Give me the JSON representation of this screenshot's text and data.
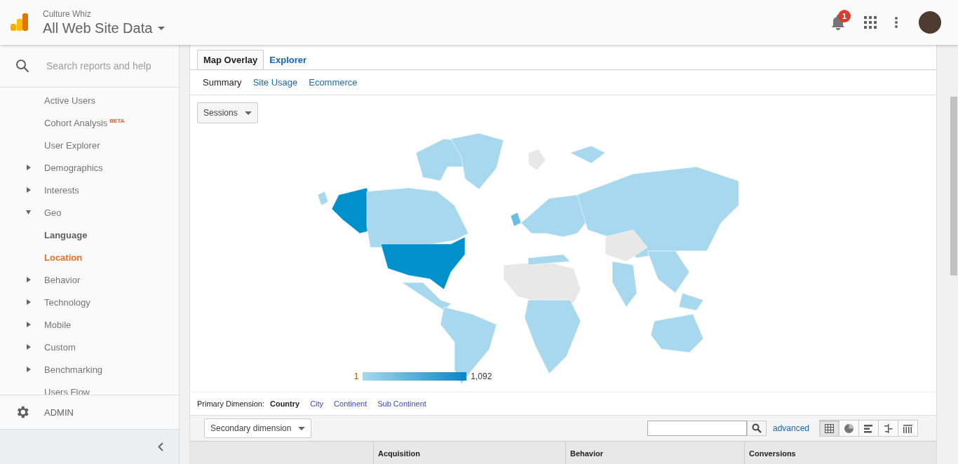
{
  "header": {
    "account": "Culture Whiz",
    "property": "All Web Site Data",
    "notifications": "1"
  },
  "sidebar": {
    "search": {
      "placeholder": "Search reports and help"
    },
    "items": [
      {
        "label": "Active Users",
        "kind": "leaf",
        "selected": false
      },
      {
        "label": "Cohort Analysis",
        "badge": "BETA",
        "kind": "leaf",
        "selected": false
      },
      {
        "label": "User Explorer",
        "kind": "leaf",
        "selected": false
      },
      {
        "label": "Demographics",
        "kind": "group",
        "expanded": false
      },
      {
        "label": "Interests",
        "kind": "group",
        "expanded": false
      },
      {
        "label": "Geo",
        "kind": "group",
        "expanded": true,
        "children": [
          {
            "label": "Language",
            "kind": "leaf",
            "selected": false
          },
          {
            "label": "Location",
            "kind": "leaf",
            "selected": true
          }
        ]
      },
      {
        "label": "Behavior",
        "kind": "group",
        "expanded": false
      },
      {
        "label": "Technology",
        "kind": "group",
        "expanded": false
      },
      {
        "label": "Mobile",
        "kind": "group",
        "expanded": false
      },
      {
        "label": "Custom",
        "kind": "group",
        "expanded": false
      },
      {
        "label": "Benchmarking",
        "kind": "group",
        "expanded": false
      },
      {
        "label": "Users Flow",
        "kind": "leaf",
        "selected": false
      }
    ],
    "admin": "ADMIN"
  },
  "tabs": [
    {
      "label": "Map Overlay",
      "selected": true
    },
    {
      "label": "Explorer",
      "selected": false
    }
  ],
  "subtabs": [
    {
      "label": "Summary",
      "selected": true
    },
    {
      "label": "Site Usage",
      "selected": false
    },
    {
      "label": "Ecommerce",
      "selected": false
    }
  ],
  "metric_dropdown": "Sessions",
  "legend": {
    "min": "1",
    "max": "1,092"
  },
  "primary_dimension": {
    "label": "Primary Dimension:",
    "options": [
      {
        "label": "Country",
        "selected": true
      },
      {
        "label": "City",
        "selected": false
      },
      {
        "label": "Continent",
        "selected": false
      },
      {
        "label": "Sub Continent",
        "selected": false
      }
    ]
  },
  "secondary_dimension": "Secondary dimension",
  "table_search": {
    "advanced": "advanced"
  },
  "view_buttons": [
    {
      "kind": "table",
      "selected": true
    },
    {
      "kind": "pie",
      "selected": false
    },
    {
      "kind": "bar",
      "selected": false
    },
    {
      "kind": "comparison",
      "selected": false
    },
    {
      "kind": "pivot",
      "selected": false
    }
  ],
  "table": {
    "groups": [
      "Acquisition",
      "Behavior",
      "Conversions"
    ]
  }
}
